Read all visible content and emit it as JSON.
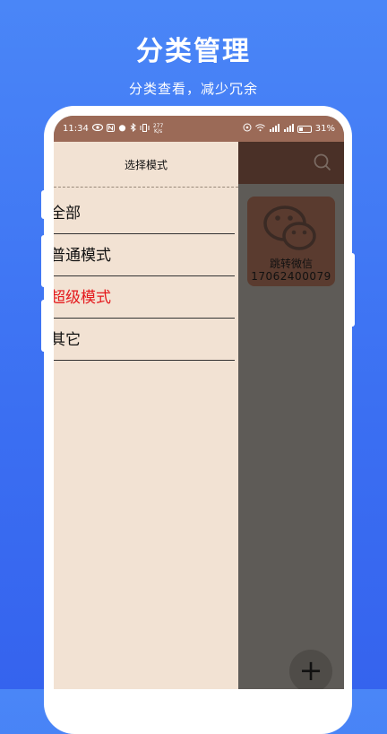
{
  "promo": {
    "title": "分类管理",
    "subtitle": "分类查看，减少冗余"
  },
  "status_bar": {
    "time": "11:34",
    "net_speed_value": "277",
    "net_speed_unit": "K/s",
    "battery": "31%"
  },
  "drawer": {
    "title": "选择模式",
    "items": [
      {
        "label": "全部",
        "active": false
      },
      {
        "label": "普通模式",
        "active": false
      },
      {
        "label": "超级模式",
        "active": true
      },
      {
        "label": "其它",
        "active": false
      }
    ]
  },
  "card": {
    "name": "跳转微信",
    "number": "17062400079"
  },
  "fab": {
    "label": "+"
  },
  "colors": {
    "background": "#3b6ff2",
    "status_bar": "#9b6a57",
    "toolbar": "#4a3027",
    "drawer": "#f2e2d3",
    "active_item": "#e4191d"
  },
  "icons": [
    "search-icon",
    "wechat-icon",
    "plus-icon",
    "eye-icon",
    "nfc-icon",
    "bluetooth-icon",
    "vibrate-icon",
    "wifi-icon",
    "signal-icon",
    "battery-icon"
  ]
}
